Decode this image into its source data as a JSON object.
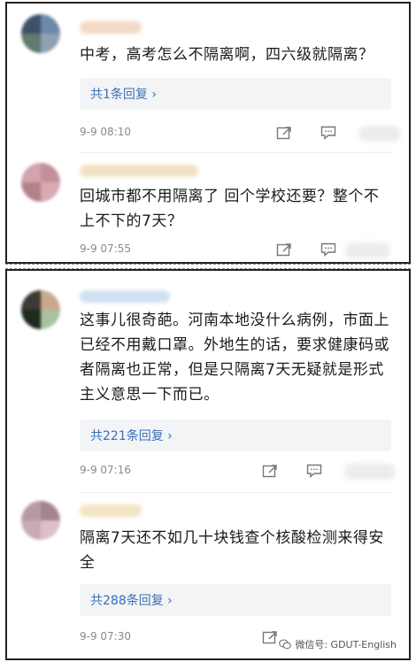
{
  "comments": [
    {
      "text": "中考，高考怎么不隔离啊，四六级就隔离？",
      "reply_label": "共1条回复 ›",
      "time": "9-9 08:10"
    },
    {
      "text": "回城市都不用隔离了 回个学校还要？整个不上不下的7天？",
      "reply_label": "",
      "time": "9-9 07:55"
    },
    {
      "text": "这事儿很奇葩。河南本地没什么病例，市面上已经不用戴口罩。外地生的话，要求健康码或者隔离也正常，但是只隔离7天无疑就是形式主义意思一下而已。",
      "reply_label": "共221条回复 ›",
      "time": "9-9 07:16"
    },
    {
      "text": "隔离7天还不如几十块钱查个核酸检测来得安全",
      "reply_label": "共288条回复 ›",
      "time": "9-9 07:30"
    }
  ],
  "watermark": "微信号: GDUT-English",
  "colors": {
    "reply": "#3b6fb6",
    "meta": "#8a8a8a",
    "reply_bg": "#f3f4f6"
  }
}
